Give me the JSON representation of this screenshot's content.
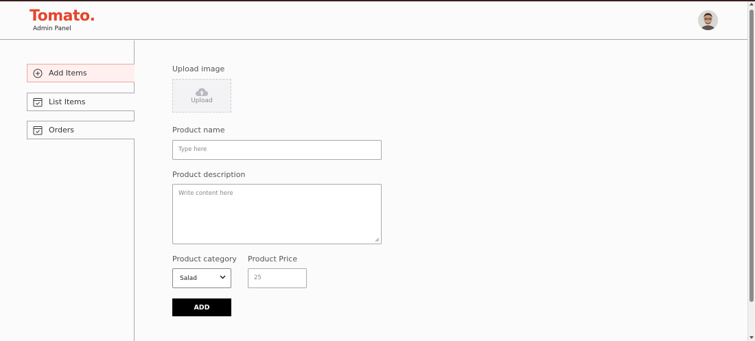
{
  "brand": {
    "title": "Tomato.",
    "subtitle": "Admin Panel",
    "accent": "#e8442c"
  },
  "header": {
    "avatar": "profile-avatar"
  },
  "sidebar": {
    "items": [
      {
        "label": "Add Items",
        "icon": "plus-circle-icon",
        "active": true
      },
      {
        "label": "List Items",
        "icon": "calendar-check-icon",
        "active": false
      },
      {
        "label": "Orders",
        "icon": "calendar-check-icon",
        "active": false
      }
    ]
  },
  "form": {
    "upload_label": "Upload image",
    "upload_text": "Upload",
    "name_label": "Product name",
    "name_placeholder": "Type here",
    "description_label": "Product description",
    "description_placeholder": "Write content here",
    "category_label": "Product category",
    "category_value": "Salad",
    "price_label": "Product Price",
    "price_value": "25",
    "submit_label": "ADD"
  }
}
